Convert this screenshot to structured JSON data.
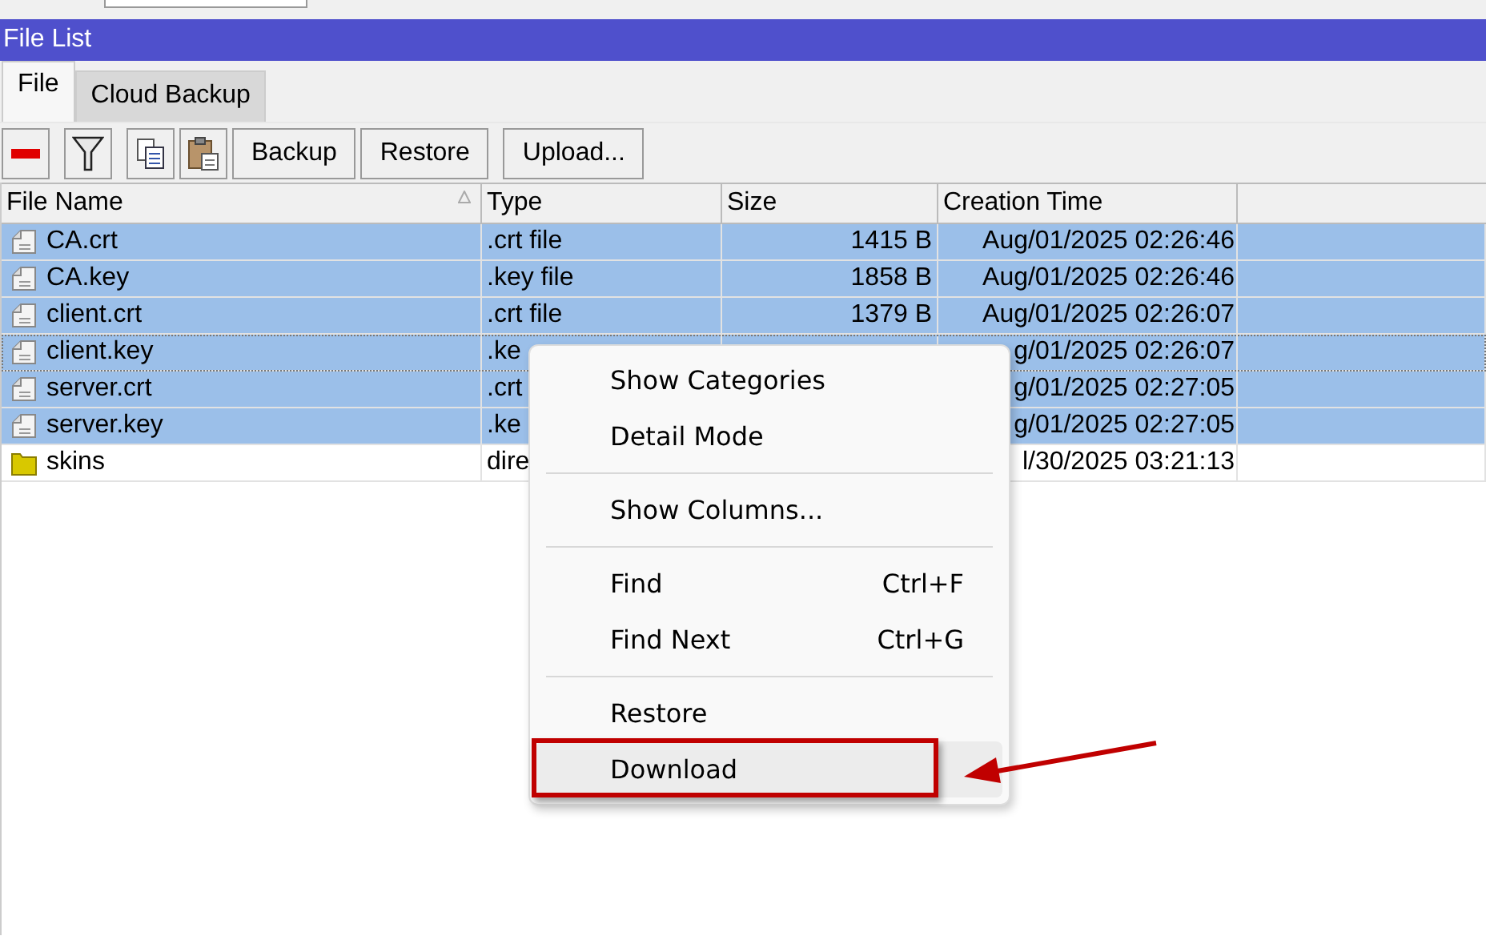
{
  "window": {
    "title": "File List"
  },
  "tabs": [
    {
      "label": "File",
      "selected": true
    },
    {
      "label": "Cloud Backup",
      "selected": false
    }
  ],
  "toolbar": [
    {
      "kind": "remove"
    },
    {
      "kind": "filter"
    },
    {
      "kind": "copy"
    },
    {
      "kind": "paste"
    },
    {
      "kind": "text",
      "label": "Backup"
    },
    {
      "kind": "text",
      "label": "Restore"
    },
    {
      "kind": "text",
      "label": "Upload..."
    }
  ],
  "table": {
    "columns": [
      {
        "label": "File Name",
        "sorted": true
      },
      {
        "label": "Type",
        "sorted": false
      },
      {
        "label": "Size",
        "sorted": false
      },
      {
        "label": "Creation Time",
        "sorted": false
      }
    ],
    "rows": [
      {
        "kind": "file",
        "name": "CA.crt",
        "type": ".crt file",
        "size": "1415 B",
        "time": "Aug/01/2025 02:26:46",
        "selected": true,
        "focused": false
      },
      {
        "kind": "file",
        "name": "CA.key",
        "type": ".key file",
        "size": "1858 B",
        "time": "Aug/01/2025 02:26:46",
        "selected": true,
        "focused": false
      },
      {
        "kind": "file",
        "name": "client.crt",
        "type": ".crt file",
        "size": "1379 B",
        "time": "Aug/01/2025 02:26:07",
        "selected": true,
        "focused": false
      },
      {
        "kind": "file",
        "name": "client.key",
        "type": ".ke",
        "time": "g/01/2025 02:26:07",
        "selected": true,
        "focused": true
      },
      {
        "kind": "file",
        "name": "server.crt",
        "type": ".crt",
        "time": "g/01/2025 02:27:05",
        "selected": true,
        "focused": false
      },
      {
        "kind": "file",
        "name": "server.key",
        "type": ".ke",
        "time": "g/01/2025 02:27:05",
        "selected": true,
        "focused": false
      },
      {
        "kind": "folder",
        "name": "skins",
        "type": "dire",
        "time": "l/30/2025 03:21:13",
        "selected": false,
        "focused": false
      }
    ]
  },
  "context_menu": {
    "groups": [
      [
        {
          "label": "Show Categories",
          "highlighted": false,
          "annotated": false
        },
        {
          "label": "Detail Mode",
          "highlighted": false,
          "annotated": false
        }
      ],
      [
        {
          "label": "Show Columns...",
          "highlighted": false,
          "annotated": false
        }
      ],
      [
        {
          "label": "Find",
          "shortcut": "Ctrl+F",
          "highlighted": false,
          "annotated": false
        },
        {
          "label": "Find Next",
          "shortcut": "Ctrl+G",
          "highlighted": false,
          "annotated": false
        }
      ],
      [
        {
          "label": "Restore",
          "highlighted": false,
          "annotated": false
        },
        {
          "label": "Download",
          "highlighted": true,
          "annotated": true
        }
      ]
    ]
  }
}
